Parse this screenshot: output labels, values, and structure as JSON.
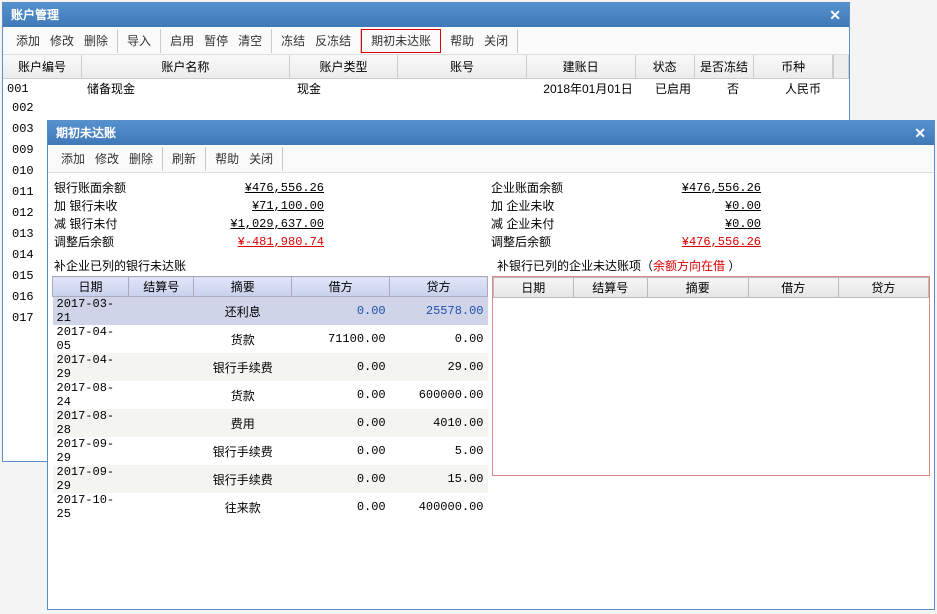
{
  "parent": {
    "title": "账户管理",
    "toolbar": {
      "g1": [
        "添加",
        "修改",
        "删除"
      ],
      "g2": [
        "导入"
      ],
      "g3": [
        "启用",
        "暂停",
        "清空"
      ],
      "g4": [
        "冻结",
        "反冻结"
      ],
      "g5": [
        "期初未达账"
      ],
      "g6": [
        "帮助",
        "关闭"
      ]
    },
    "headers": {
      "id": "账户编号",
      "name": "账户名称",
      "type": "账户类型",
      "acct": "账号",
      "date": "建账日",
      "status": "状态",
      "frozen": "是否冻结",
      "curr": "币种"
    },
    "row": {
      "id": "001",
      "name": "储备现金",
      "type": "现金",
      "acct": "",
      "date": "2018年01月01日",
      "status": "已启用",
      "frozen": "否",
      "curr": "人民币"
    },
    "ids": [
      "002",
      "003",
      "009",
      "010",
      "011",
      "012",
      "013",
      "014",
      "015",
      "016",
      "017"
    ]
  },
  "child": {
    "title": "期初未达账",
    "toolbar": {
      "g1": [
        "添加",
        "修改",
        "删除"
      ],
      "g2": [
        "刷新"
      ],
      "g3": [
        "帮助",
        "关闭"
      ]
    },
    "left_summary": [
      {
        "label": "银行账面余额",
        "value": "¥476,556.26"
      },
      {
        "label": "加 银行未收",
        "value": "¥71,100.00"
      },
      {
        "label": "减 银行未付",
        "value": "¥1,029,637.00"
      },
      {
        "label": "调整后余额",
        "value": "¥-481,980.74",
        "red": true
      }
    ],
    "right_summary": [
      {
        "label": "企业账面余额",
        "value": "¥476,556.26"
      },
      {
        "label": "加 企业未收",
        "value": "¥0.00"
      },
      {
        "label": "减 企业未付",
        "value": "¥0.00"
      },
      {
        "label": "调整后余额",
        "value": "¥476,556.26",
        "red": true
      }
    ],
    "left_caption": "补企业已列的银行未达账",
    "right_caption_a": "补银行已列的企业未达账项（",
    "right_caption_b": "余额方向在借",
    "right_caption_c": "  ）",
    "table_headers": {
      "date": "日期",
      "set": "结算号",
      "sum": "摘要",
      "deb": "借方",
      "cre": "贷方"
    },
    "left_rows": [
      {
        "date": "2017-03-21",
        "sum": "还利息",
        "deb": "0.00",
        "cre": "25578.00",
        "sel": true
      },
      {
        "date": "2017-04-05",
        "sum": "货款",
        "deb": "71100.00",
        "cre": "0.00"
      },
      {
        "date": "2017-04-29",
        "sum": "银行手续费",
        "deb": "0.00",
        "cre": "29.00",
        "alt": true
      },
      {
        "date": "2017-08-24",
        "sum": "货款",
        "deb": "0.00",
        "cre": "600000.00"
      },
      {
        "date": "2017-08-28",
        "sum": "费用",
        "deb": "0.00",
        "cre": "4010.00",
        "alt": true
      },
      {
        "date": "2017-09-29",
        "sum": "银行手续费",
        "deb": "0.00",
        "cre": "5.00"
      },
      {
        "date": "2017-09-29",
        "sum": "银行手续费",
        "deb": "0.00",
        "cre": "15.00",
        "alt": true
      },
      {
        "date": "2017-10-25",
        "sum": "往来款",
        "deb": "0.00",
        "cre": "400000.00"
      }
    ]
  }
}
